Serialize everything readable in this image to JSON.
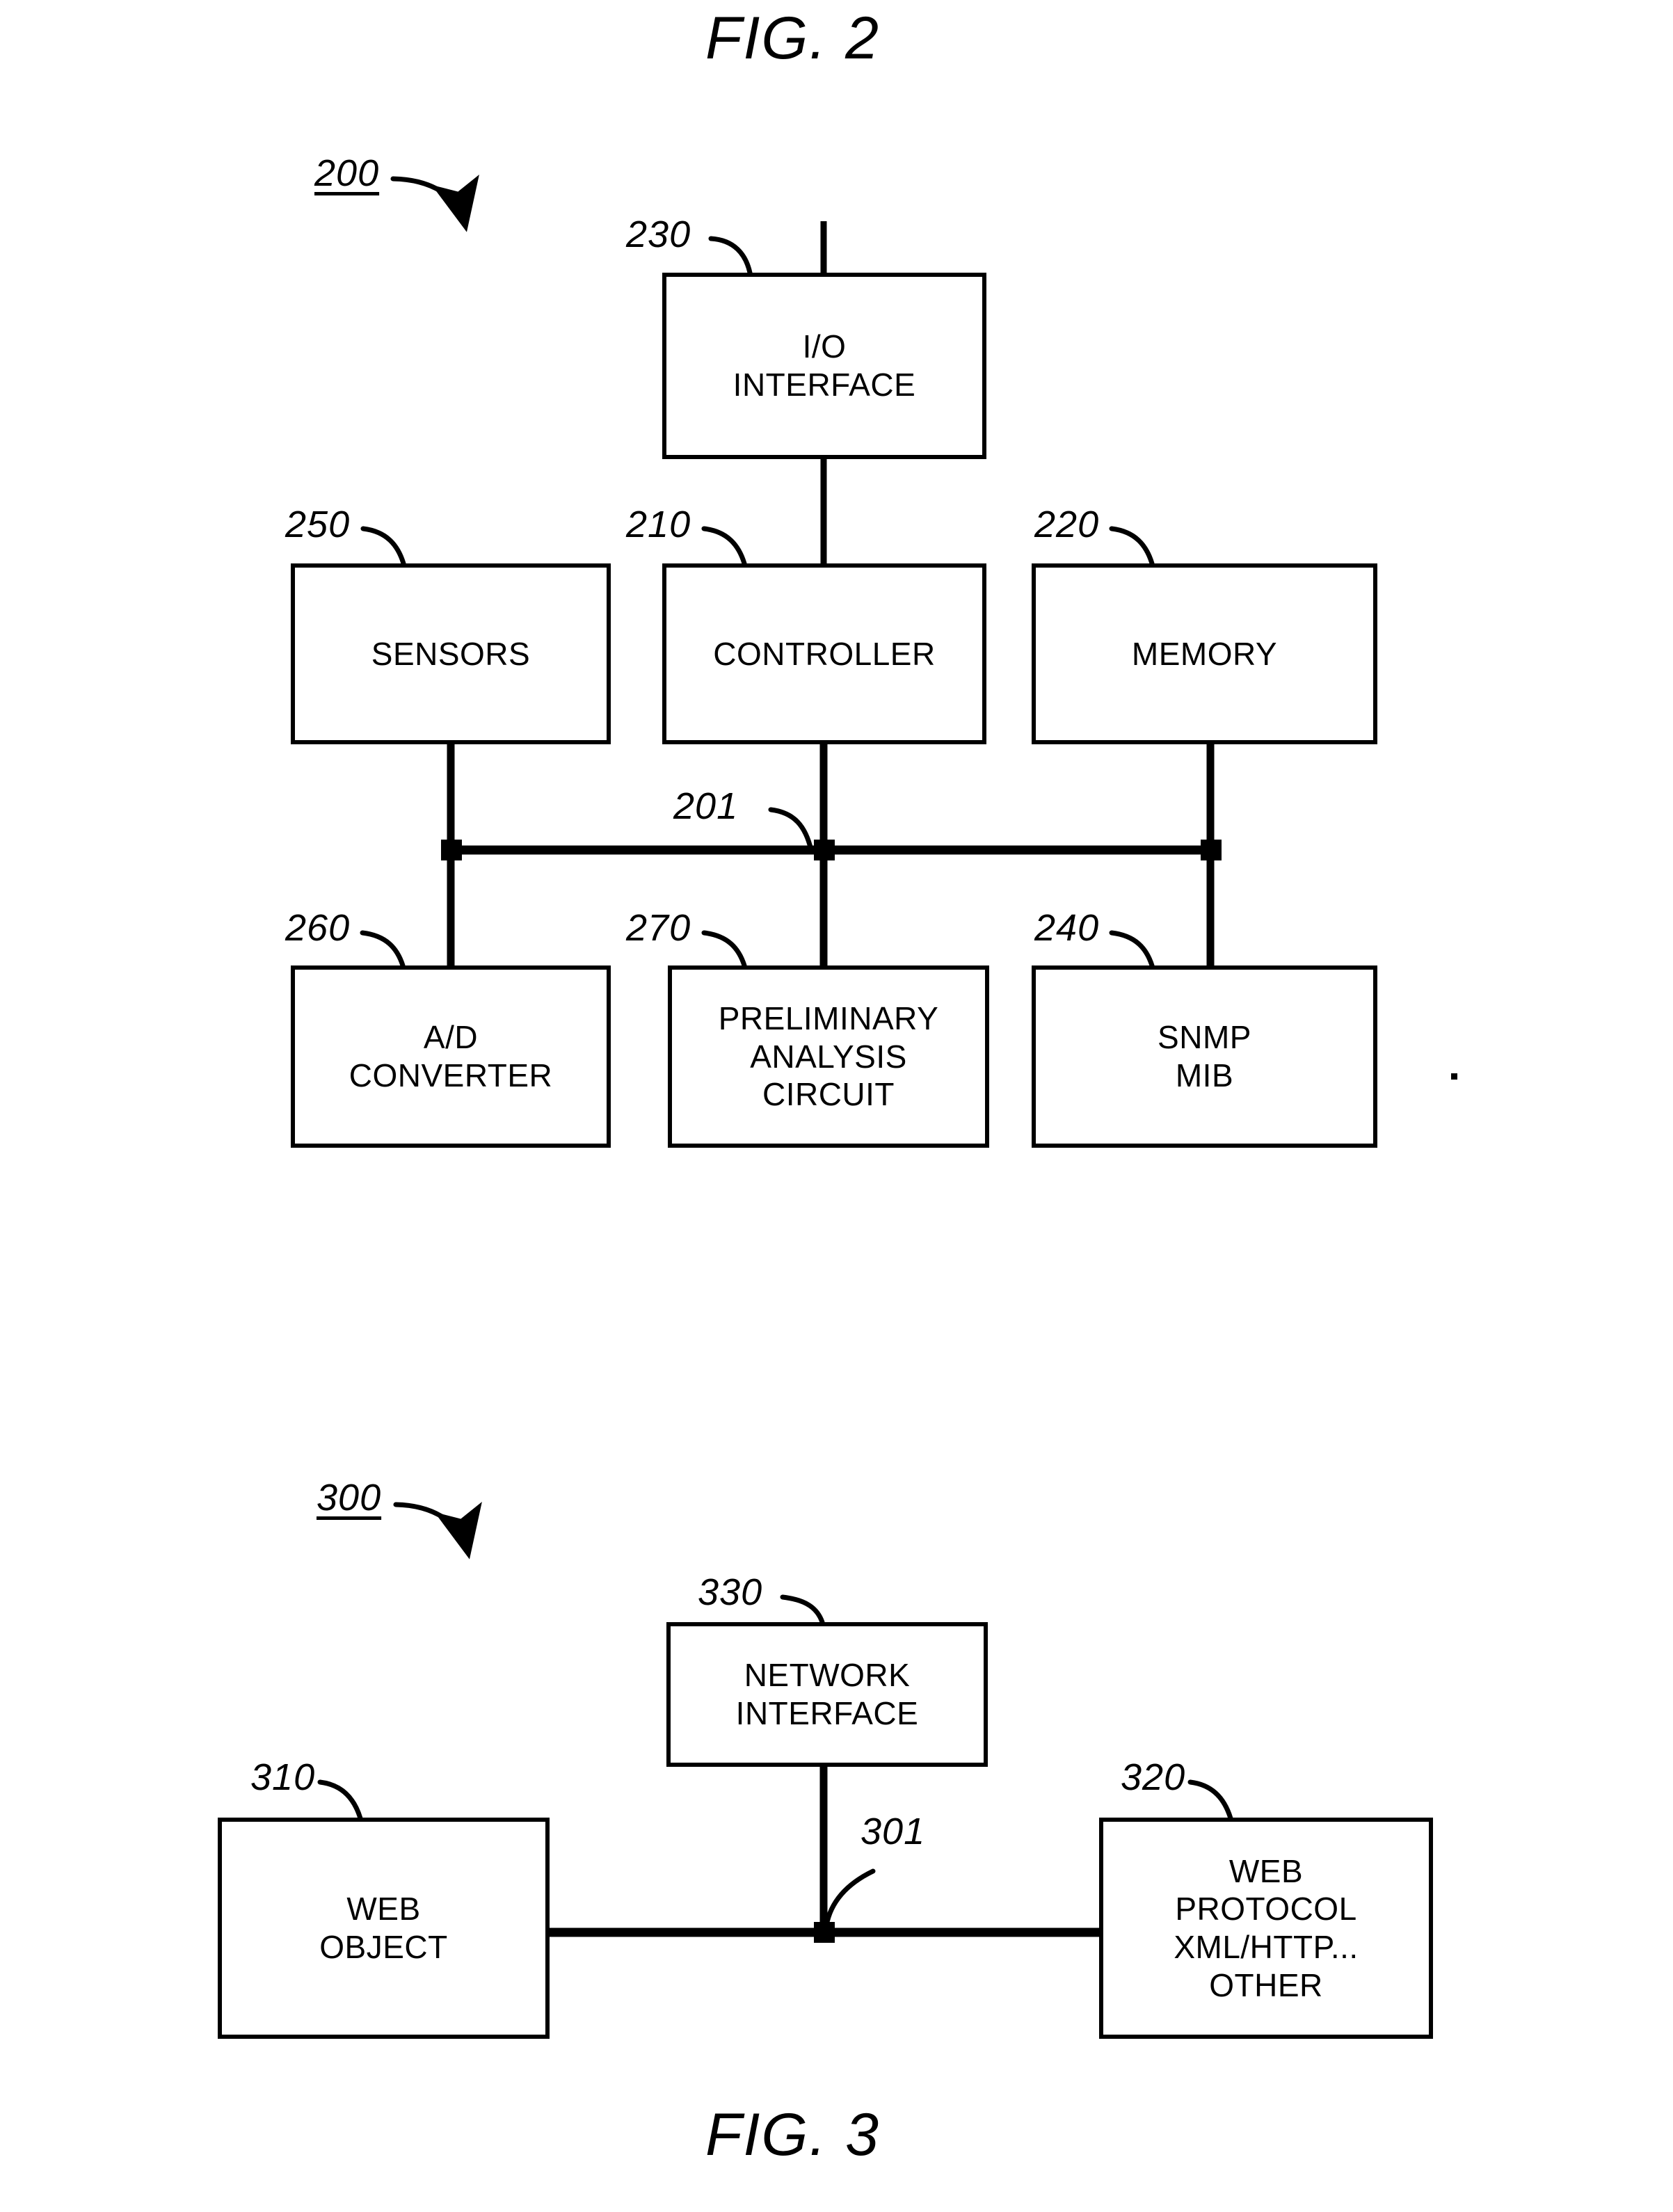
{
  "document": {
    "type": "patent-drawing-sheet",
    "figures": [
      "FIG. 2",
      "FIG. 3"
    ]
  },
  "fig2": {
    "title": "FIG. 2",
    "system_ref": "200",
    "bus_ref": "201",
    "blocks": [
      {
        "ref": "230",
        "label": "I/O\nINTERFACE"
      },
      {
        "ref": "250",
        "label": "SENSORS"
      },
      {
        "ref": "210",
        "label": "CONTROLLER"
      },
      {
        "ref": "220",
        "label": "MEMORY"
      },
      {
        "ref": "260",
        "label": "A/D\nCONVERTER"
      },
      {
        "ref": "270",
        "label": "PRELIMINARY\nANALYSIS\nCIRCUIT"
      },
      {
        "ref": "240",
        "label": "SNMP\nMIB"
      }
    ]
  },
  "fig3": {
    "title": "FIG. 3",
    "system_ref": "300",
    "bus_ref": "301",
    "blocks": [
      {
        "ref": "330",
        "label": "NETWORK\nINTERFACE"
      },
      {
        "ref": "310",
        "label": "WEB\nOBJECT"
      },
      {
        "ref": "320",
        "label": "WEB\nPROTOCOL\nXML/HTTP...\nOTHER"
      }
    ]
  },
  "colors": {
    "ink": "#000000",
    "paper": "#ffffff"
  }
}
